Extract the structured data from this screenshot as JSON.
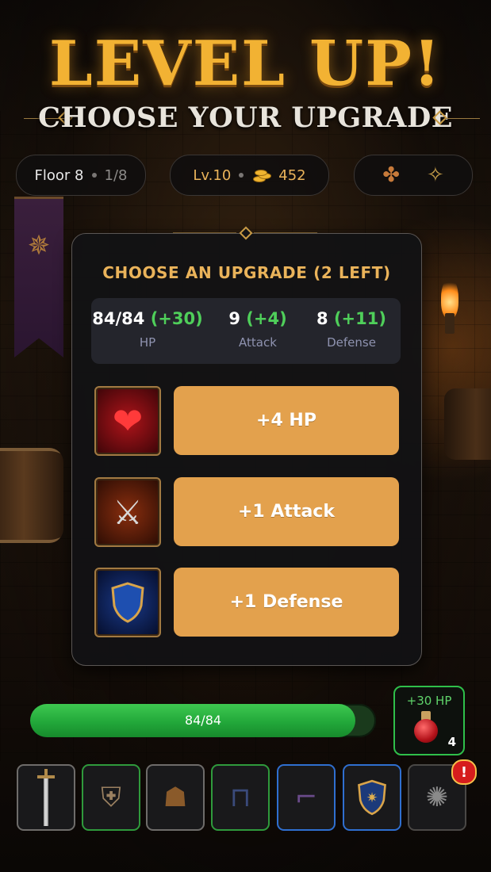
{
  "header": {
    "title": "LEVEL UP!",
    "subtitle": "CHOOSE YOUR UPGRADE"
  },
  "status": {
    "floor_label": "Floor 8",
    "floor_progress": "1/8",
    "level": "Lv.10",
    "gold": "452",
    "bag_icon": "bag-icon",
    "compass_icon": "compass-icon"
  },
  "panel": {
    "title": "CHOOSE AN UPGRADE (2 LEFT)",
    "stats": [
      {
        "value": "84/84",
        "gain": "(+30)",
        "label": "HP"
      },
      {
        "value": "9",
        "gain": "(+4)",
        "label": "Attack"
      },
      {
        "value": "8",
        "gain": "(+11)",
        "label": "Defense"
      }
    ],
    "upgrades": [
      {
        "label": "+4 HP",
        "icon": "heart-icon"
      },
      {
        "label": "+1 Attack",
        "icon": "sword-icon"
      },
      {
        "label": "+1 Defense",
        "icon": "shield-icon"
      }
    ]
  },
  "hp_bar": {
    "text": "84/84",
    "fraction": 0.94,
    "color": "#2fb845"
  },
  "potion": {
    "label": "+30 HP",
    "count": "4",
    "icon": "potion-icon"
  },
  "equipment": {
    "slots": [
      {
        "icon": "sword-icon",
        "border": "gray"
      },
      {
        "icon": "armor-icon",
        "border": "green"
      },
      {
        "icon": "hood-icon",
        "border": "gray"
      },
      {
        "icon": "pants-icon",
        "border": "green"
      },
      {
        "icon": "boots-icon",
        "border": "blue"
      },
      {
        "icon": "shield-icon",
        "border": "blue"
      },
      {
        "icon": "amulet-icon",
        "border": "plain"
      }
    ],
    "alert_text": "!"
  },
  "colors": {
    "accent_gold": "#f2b233",
    "button": "#e3a14d",
    "gain_green": "#4fcf5a"
  }
}
